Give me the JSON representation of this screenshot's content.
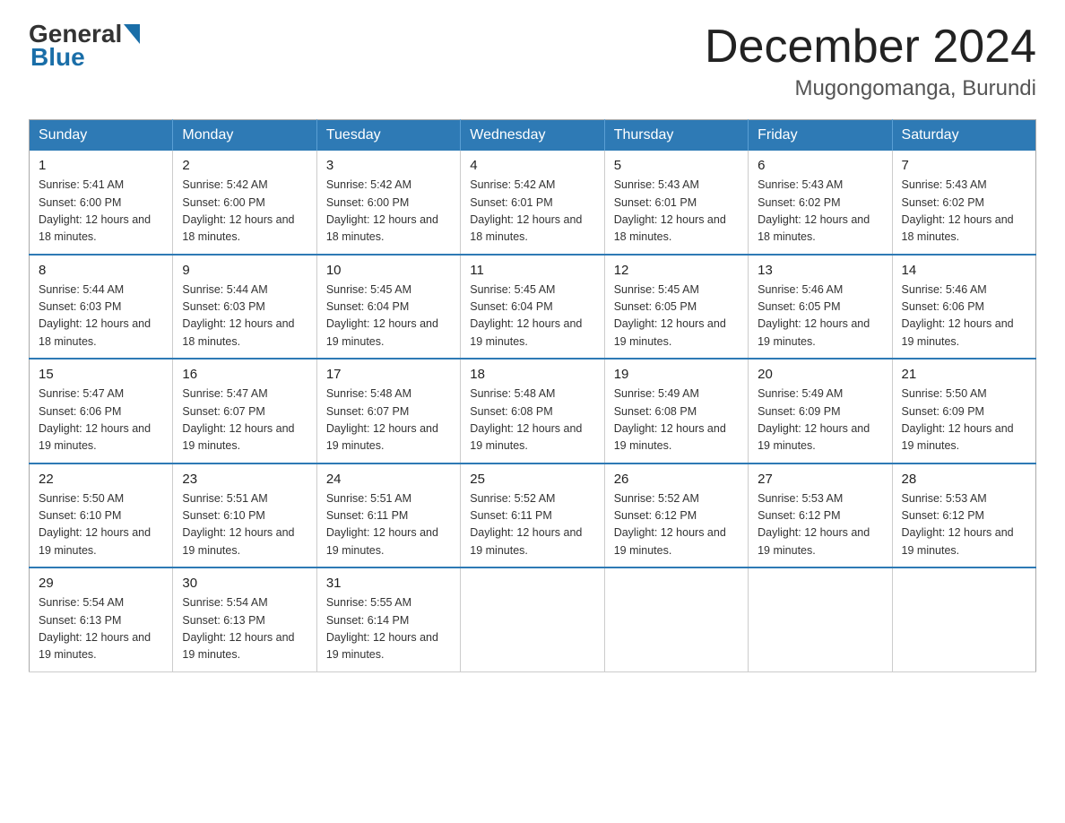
{
  "logo": {
    "general": "General",
    "blue": "Blue"
  },
  "title": {
    "month_year": "December 2024",
    "location": "Mugongomanga, Burundi"
  },
  "headers": [
    "Sunday",
    "Monday",
    "Tuesday",
    "Wednesday",
    "Thursday",
    "Friday",
    "Saturday"
  ],
  "weeks": [
    [
      {
        "day": "1",
        "sunrise": "5:41 AM",
        "sunset": "6:00 PM",
        "daylight": "12 hours and 18 minutes."
      },
      {
        "day": "2",
        "sunrise": "5:42 AM",
        "sunset": "6:00 PM",
        "daylight": "12 hours and 18 minutes."
      },
      {
        "day": "3",
        "sunrise": "5:42 AM",
        "sunset": "6:00 PM",
        "daylight": "12 hours and 18 minutes."
      },
      {
        "day": "4",
        "sunrise": "5:42 AM",
        "sunset": "6:01 PM",
        "daylight": "12 hours and 18 minutes."
      },
      {
        "day": "5",
        "sunrise": "5:43 AM",
        "sunset": "6:01 PM",
        "daylight": "12 hours and 18 minutes."
      },
      {
        "day": "6",
        "sunrise": "5:43 AM",
        "sunset": "6:02 PM",
        "daylight": "12 hours and 18 minutes."
      },
      {
        "day": "7",
        "sunrise": "5:43 AM",
        "sunset": "6:02 PM",
        "daylight": "12 hours and 18 minutes."
      }
    ],
    [
      {
        "day": "8",
        "sunrise": "5:44 AM",
        "sunset": "6:03 PM",
        "daylight": "12 hours and 18 minutes."
      },
      {
        "day": "9",
        "sunrise": "5:44 AM",
        "sunset": "6:03 PM",
        "daylight": "12 hours and 18 minutes."
      },
      {
        "day": "10",
        "sunrise": "5:45 AM",
        "sunset": "6:04 PM",
        "daylight": "12 hours and 19 minutes."
      },
      {
        "day": "11",
        "sunrise": "5:45 AM",
        "sunset": "6:04 PM",
        "daylight": "12 hours and 19 minutes."
      },
      {
        "day": "12",
        "sunrise": "5:45 AM",
        "sunset": "6:05 PM",
        "daylight": "12 hours and 19 minutes."
      },
      {
        "day": "13",
        "sunrise": "5:46 AM",
        "sunset": "6:05 PM",
        "daylight": "12 hours and 19 minutes."
      },
      {
        "day": "14",
        "sunrise": "5:46 AM",
        "sunset": "6:06 PM",
        "daylight": "12 hours and 19 minutes."
      }
    ],
    [
      {
        "day": "15",
        "sunrise": "5:47 AM",
        "sunset": "6:06 PM",
        "daylight": "12 hours and 19 minutes."
      },
      {
        "day": "16",
        "sunrise": "5:47 AM",
        "sunset": "6:07 PM",
        "daylight": "12 hours and 19 minutes."
      },
      {
        "day": "17",
        "sunrise": "5:48 AM",
        "sunset": "6:07 PM",
        "daylight": "12 hours and 19 minutes."
      },
      {
        "day": "18",
        "sunrise": "5:48 AM",
        "sunset": "6:08 PM",
        "daylight": "12 hours and 19 minutes."
      },
      {
        "day": "19",
        "sunrise": "5:49 AM",
        "sunset": "6:08 PM",
        "daylight": "12 hours and 19 minutes."
      },
      {
        "day": "20",
        "sunrise": "5:49 AM",
        "sunset": "6:09 PM",
        "daylight": "12 hours and 19 minutes."
      },
      {
        "day": "21",
        "sunrise": "5:50 AM",
        "sunset": "6:09 PM",
        "daylight": "12 hours and 19 minutes."
      }
    ],
    [
      {
        "day": "22",
        "sunrise": "5:50 AM",
        "sunset": "6:10 PM",
        "daylight": "12 hours and 19 minutes."
      },
      {
        "day": "23",
        "sunrise": "5:51 AM",
        "sunset": "6:10 PM",
        "daylight": "12 hours and 19 minutes."
      },
      {
        "day": "24",
        "sunrise": "5:51 AM",
        "sunset": "6:11 PM",
        "daylight": "12 hours and 19 minutes."
      },
      {
        "day": "25",
        "sunrise": "5:52 AM",
        "sunset": "6:11 PM",
        "daylight": "12 hours and 19 minutes."
      },
      {
        "day": "26",
        "sunrise": "5:52 AM",
        "sunset": "6:12 PM",
        "daylight": "12 hours and 19 minutes."
      },
      {
        "day": "27",
        "sunrise": "5:53 AM",
        "sunset": "6:12 PM",
        "daylight": "12 hours and 19 minutes."
      },
      {
        "day": "28",
        "sunrise": "5:53 AM",
        "sunset": "6:12 PM",
        "daylight": "12 hours and 19 minutes."
      }
    ],
    [
      {
        "day": "29",
        "sunrise": "5:54 AM",
        "sunset": "6:13 PM",
        "daylight": "12 hours and 19 minutes."
      },
      {
        "day": "30",
        "sunrise": "5:54 AM",
        "sunset": "6:13 PM",
        "daylight": "12 hours and 19 minutes."
      },
      {
        "day": "31",
        "sunrise": "5:55 AM",
        "sunset": "6:14 PM",
        "daylight": "12 hours and 19 minutes."
      },
      null,
      null,
      null,
      null
    ]
  ]
}
